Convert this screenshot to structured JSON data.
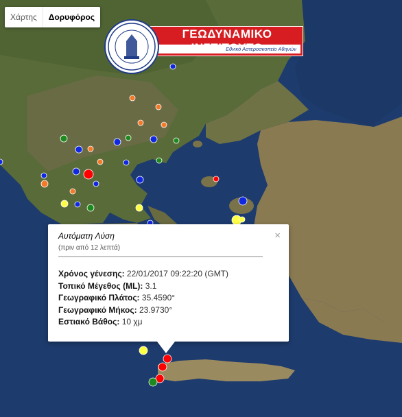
{
  "map_type": {
    "map": "Χάρτης",
    "satellite": "Δορυφόρος",
    "selected": "satellite"
  },
  "banner": {
    "title": "ΓΕΩΔΥΝΑΜΙΚΟ ΙΝΣΤΙΤΟΥΤΟ",
    "subtitle": "Εθνικό Αστεροσκοπείο Αθηνών"
  },
  "popup": {
    "title": "Αυτόματη Λύση",
    "time_ago": "(πριν από 12 λεπτά)",
    "close": "×",
    "rows": [
      {
        "label": "Χρόνος γένεσης:",
        "value": "22/01/2017  09:22:20 (GMT)"
      },
      {
        "label": "Τοπικό Μέγεθος (ML):",
        "value": "3.1"
      },
      {
        "label": "Γεωγραφικό Πλάτος:",
        "value": "35.4590°"
      },
      {
        "label": "Γεωγραφικό Μήκος:",
        "value": "23.9730°"
      },
      {
        "label": "Εστιακό Βάθος:",
        "value": "10 χμ"
      }
    ]
  },
  "colors": {
    "red": "#ff0000",
    "orange": "#f27a2a",
    "yellow": "#ffff44",
    "green": "#1e8a1e",
    "blue": "#1028e0"
  }
}
